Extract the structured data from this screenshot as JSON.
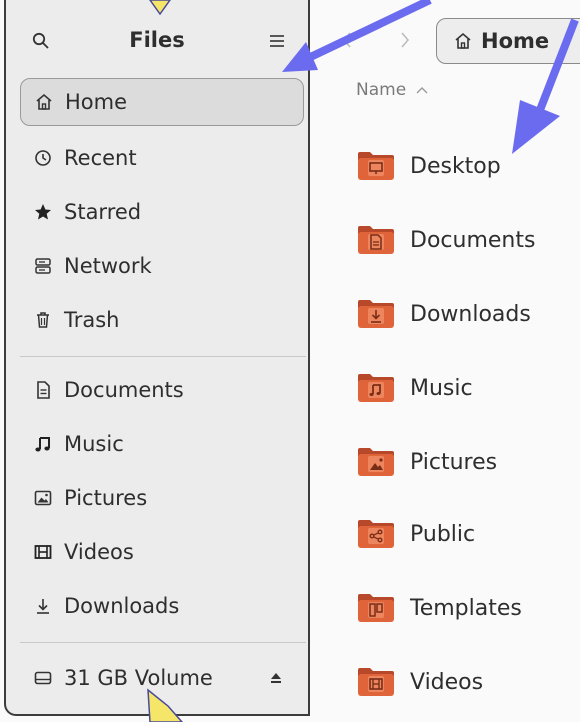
{
  "sidebar": {
    "title": "Files",
    "places": [
      {
        "label": "Home",
        "icon": "home-icon",
        "active": true
      },
      {
        "label": "Recent",
        "icon": "clock-icon"
      },
      {
        "label": "Starred",
        "icon": "star-icon"
      },
      {
        "label": "Network",
        "icon": "network-icon"
      },
      {
        "label": "Trash",
        "icon": "trash-icon"
      }
    ],
    "bookmarks": [
      {
        "label": "Documents",
        "icon": "document-icon"
      },
      {
        "label": "Music",
        "icon": "music-icon"
      },
      {
        "label": "Pictures",
        "icon": "picture-icon"
      },
      {
        "label": "Videos",
        "icon": "video-icon"
      },
      {
        "label": "Downloads",
        "icon": "download-icon"
      }
    ],
    "volume": {
      "label": "31 GB Volume",
      "icon": "drive-icon",
      "eject_icon": "eject-icon"
    }
  },
  "toolbar": {
    "path_label": "Home",
    "path_icon": "home-icon"
  },
  "list": {
    "column_name": "Name",
    "sort_icon": "sort-ascending-icon",
    "files": [
      {
        "name": "Desktop",
        "emblem": "desktop"
      },
      {
        "name": "Documents",
        "emblem": "document"
      },
      {
        "name": "Downloads",
        "emblem": "download"
      },
      {
        "name": "Music",
        "emblem": "music"
      },
      {
        "name": "Pictures",
        "emblem": "picture"
      },
      {
        "name": "Public",
        "emblem": "share"
      },
      {
        "name": "Templates",
        "emblem": "template"
      },
      {
        "name": "Videos",
        "emblem": "video"
      }
    ]
  },
  "colors": {
    "folder": "#e0643a",
    "folder_dark": "#b8482a",
    "arrow": "#6b6bf0",
    "arrow_yellow": "#f5e66a"
  }
}
